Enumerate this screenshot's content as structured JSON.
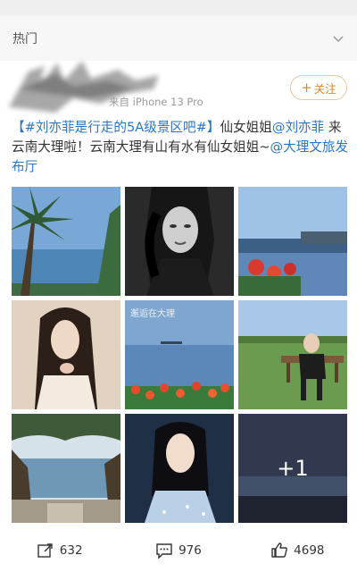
{
  "header": {
    "title": "热门",
    "icon": "chevron-down-icon"
  },
  "post": {
    "source_prefix": "来自",
    "device": "iPhone 13 Pro",
    "follow_label": "关注",
    "text": {
      "topic": "【#刘亦菲是行走的5A级景区吧#】",
      "part1": "仙女姐姐",
      "mention1": "@刘亦菲",
      "part2": " 来云南大理啦！云南大理有山有水有仙女姐姐~",
      "mention2": "@大理文旅发布厅"
    },
    "images": {
      "tile5_caption": "邂逅在大理",
      "more_count": "+1"
    },
    "stats": {
      "reposts": "632",
      "comments": "976",
      "likes": "4698"
    }
  },
  "colors": {
    "accent": "#d48a2c",
    "link": "#2a74c4",
    "header_bg": "#f7f7f7"
  }
}
